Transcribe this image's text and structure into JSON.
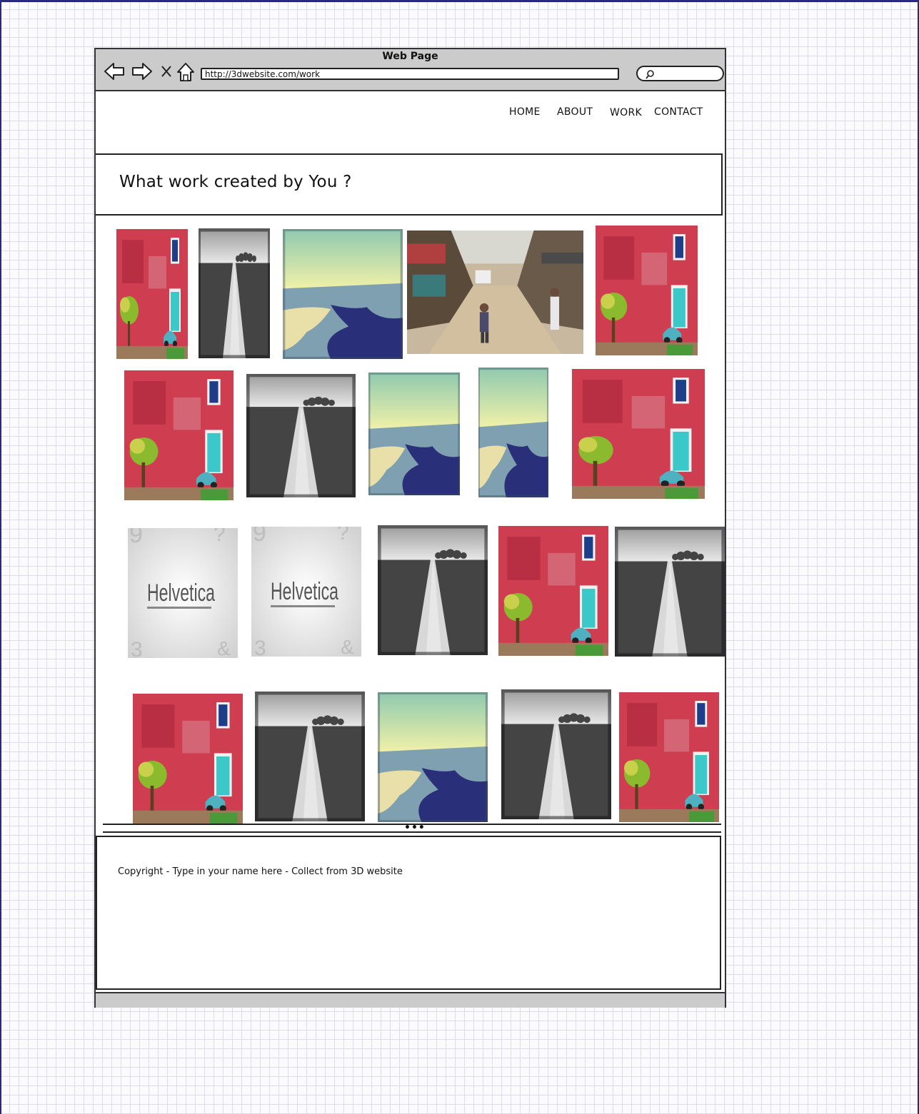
{
  "browser": {
    "window_title": "Web Page",
    "url": "http://3dwebsite.com/work",
    "search_placeholder": ""
  },
  "nav": {
    "items": [
      {
        "label": "HOME"
      },
      {
        "label": "ABOUT"
      },
      {
        "label": "WORK"
      },
      {
        "label": "CONTACT"
      }
    ]
  },
  "hero": {
    "title": "What work created by You ?"
  },
  "gallery": {
    "thumbnails": [
      {
        "kind": "red-wall"
      },
      {
        "kind": "bw-path"
      },
      {
        "kind": "beach"
      },
      {
        "kind": "street"
      },
      {
        "kind": "red-wall"
      },
      {
        "kind": "red-wall"
      },
      {
        "kind": "bw-path"
      },
      {
        "kind": "beach"
      },
      {
        "kind": "beach"
      },
      {
        "kind": "red-wall"
      },
      {
        "kind": "helvetica",
        "logo_text": "Helvetica"
      },
      {
        "kind": "helvetica",
        "logo_text": "Helvetica"
      },
      {
        "kind": "bw-path"
      },
      {
        "kind": "red-wall"
      },
      {
        "kind": "bw-path"
      },
      {
        "kind": "red-wall"
      },
      {
        "kind": "bw-path"
      },
      {
        "kind": "beach"
      },
      {
        "kind": "bw-path"
      },
      {
        "kind": "red-wall"
      }
    ]
  },
  "footer": {
    "text": "Copyright - Type in your name here - Collect from 3D website"
  },
  "colors": {
    "chrome_gray": "#cbcbcb",
    "grid_line": "#dcdde6",
    "frame_blue": "#2a2a7a"
  }
}
